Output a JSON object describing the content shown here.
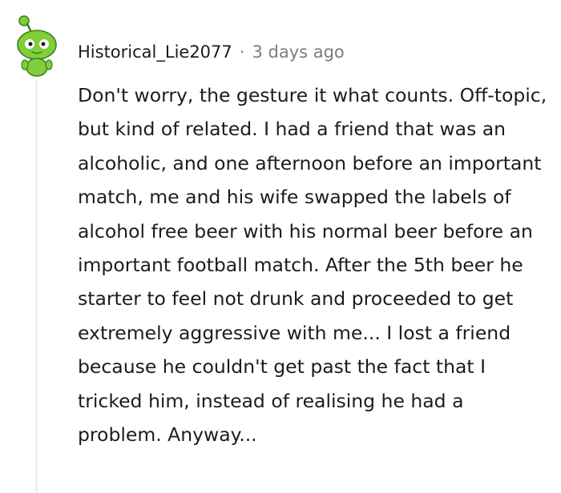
{
  "comment": {
    "author": "Historical_Lie2077",
    "separator": "·",
    "timestamp": "3 days ago",
    "avatar_icon": "reddit-snoo-green-avatar-icon",
    "text": "Don't worry, the gesture it what counts. Off-topic, but kind of related. I had a friend that was an alcoholic, and one afternoon before an important match, me and his wife swapped the labels of alcohol free beer with his normal beer before an important football match. After the 5th beer he starter to feel not drunk and proceeded to get extremely aggressive with me... I lost a friend because he couldn't get past the fact that I tricked him, instead of realising he had a problem. Anyway..."
  },
  "colors": {
    "avatar_green": "#7ecf3a",
    "text": "#1c1c1c",
    "meta": "#7c7c7c",
    "thread_line": "#edeff1"
  }
}
